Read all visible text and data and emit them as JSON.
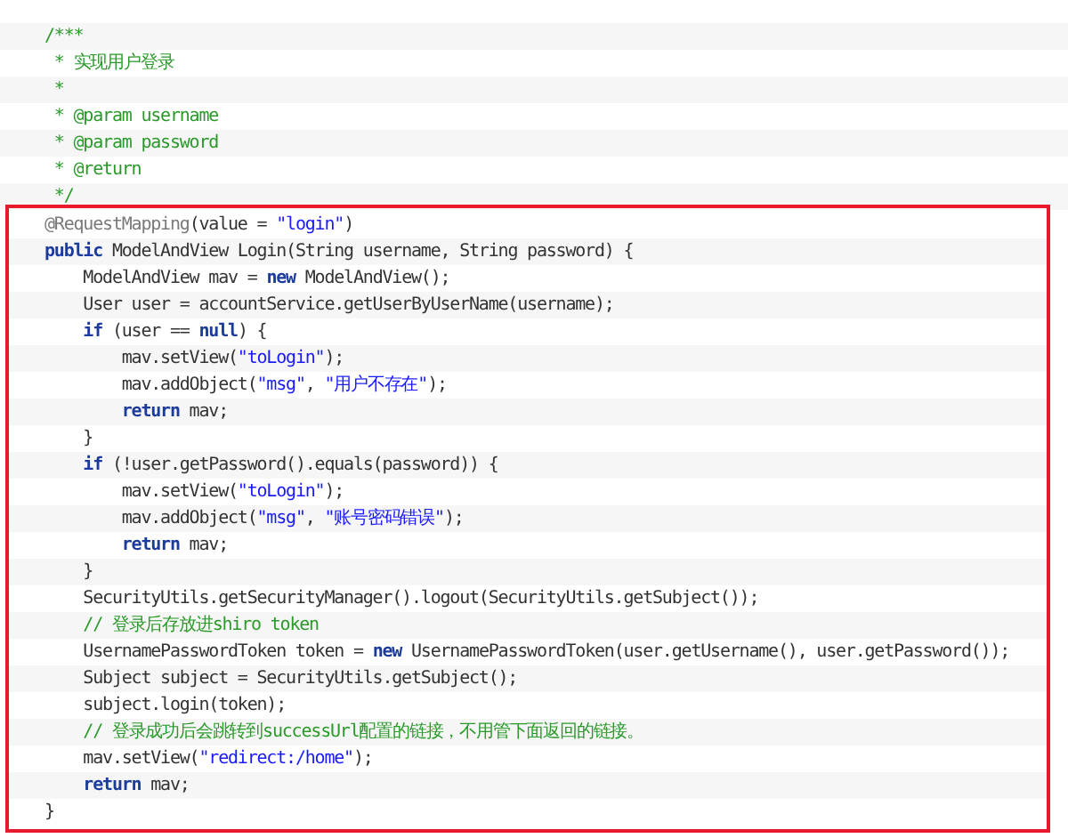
{
  "code_lines": [
    [
      {
        "kind": "comment",
        "text": "/***"
      }
    ],
    [
      {
        "kind": "comment",
        "text": " * 实现用户登录"
      }
    ],
    [
      {
        "kind": "comment",
        "text": " *"
      }
    ],
    [
      {
        "kind": "comment",
        "text": " * @param username"
      }
    ],
    [
      {
        "kind": "comment",
        "text": " * @param password"
      }
    ],
    [
      {
        "kind": "comment",
        "text": " * @return"
      }
    ],
    [
      {
        "kind": "comment",
        "text": " */"
      }
    ]
  ],
  "highlighted_block": {
    "lines": [
      [
        {
          "kind": "annotation",
          "text": "@RequestMapping"
        },
        {
          "kind": "plain",
          "text": "(value = "
        },
        {
          "kind": "string",
          "text": "\"login\""
        },
        {
          "kind": "plain",
          "text": ")"
        }
      ],
      [
        {
          "kind": "keyword",
          "text": "public"
        },
        {
          "kind": "plain",
          "text": " ModelAndView Login(String username, String password) {"
        }
      ],
      [
        {
          "kind": "plain",
          "text": "    ModelAndView mav = "
        },
        {
          "kind": "keyword",
          "text": "new"
        },
        {
          "kind": "plain",
          "text": " ModelAndView();"
        }
      ],
      [
        {
          "kind": "plain",
          "text": "    User user = accountService.getUserByUserName(username);"
        }
      ],
      [
        {
          "kind": "keyword",
          "text": "    if"
        },
        {
          "kind": "plain",
          "text": " (user == "
        },
        {
          "kind": "keyword",
          "text": "null"
        },
        {
          "kind": "plain",
          "text": ") {"
        }
      ],
      [
        {
          "kind": "plain",
          "text": "        mav.setView("
        },
        {
          "kind": "string",
          "text": "\"toLogin\""
        },
        {
          "kind": "plain",
          "text": ");"
        }
      ],
      [
        {
          "kind": "plain",
          "text": "        mav.addObject("
        },
        {
          "kind": "string",
          "text": "\"msg\""
        },
        {
          "kind": "plain",
          "text": ", "
        },
        {
          "kind": "string",
          "text": "\"用户不存在\""
        },
        {
          "kind": "plain",
          "text": ");"
        }
      ],
      [
        {
          "kind": "keyword",
          "text": "        return"
        },
        {
          "kind": "plain",
          "text": " mav;"
        }
      ],
      [
        {
          "kind": "plain",
          "text": "    }"
        }
      ],
      [
        {
          "kind": "keyword",
          "text": "    if"
        },
        {
          "kind": "plain",
          "text": " (!user.getPassword().equals(password)) {"
        }
      ],
      [
        {
          "kind": "plain",
          "text": "        mav.setView("
        },
        {
          "kind": "string",
          "text": "\"toLogin\""
        },
        {
          "kind": "plain",
          "text": ");"
        }
      ],
      [
        {
          "kind": "plain",
          "text": "        mav.addObject("
        },
        {
          "kind": "string",
          "text": "\"msg\""
        },
        {
          "kind": "plain",
          "text": ", "
        },
        {
          "kind": "string",
          "text": "\"账号密码错误\""
        },
        {
          "kind": "plain",
          "text": ");"
        }
      ],
      [
        {
          "kind": "keyword",
          "text": "        return"
        },
        {
          "kind": "plain",
          "text": " mav;"
        }
      ],
      [
        {
          "kind": "plain",
          "text": "    }"
        }
      ],
      [
        {
          "kind": "plain",
          "text": "    SecurityUtils.getSecurityManager().logout(SecurityUtils.getSubject());"
        }
      ],
      [
        {
          "kind": "comment",
          "text": "    // 登录后存放进shiro token"
        }
      ],
      [
        {
          "kind": "plain",
          "text": "    UsernamePasswordToken token = "
        },
        {
          "kind": "keyword",
          "text": "new"
        },
        {
          "kind": "plain",
          "text": " UsernamePasswordToken(user.getUsername(), user.getPassword());"
        }
      ],
      [
        {
          "kind": "plain",
          "text": "    Subject subject = SecurityUtils.getSubject();"
        }
      ],
      [
        {
          "kind": "plain",
          "text": "    subject.login(token);"
        }
      ],
      [
        {
          "kind": "comment",
          "text": "    // 登录成功后会跳转到successUrl配置的链接，不用管下面返回的链接。"
        }
      ],
      [
        {
          "kind": "plain",
          "text": "    mav.setView("
        },
        {
          "kind": "string",
          "text": "\"redirect:/home\""
        },
        {
          "kind": "plain",
          "text": ");"
        }
      ],
      [
        {
          "kind": "keyword",
          "text": "    return"
        },
        {
          "kind": "plain",
          "text": " mav;"
        }
      ],
      [
        {
          "kind": "plain",
          "text": "}"
        }
      ]
    ]
  }
}
